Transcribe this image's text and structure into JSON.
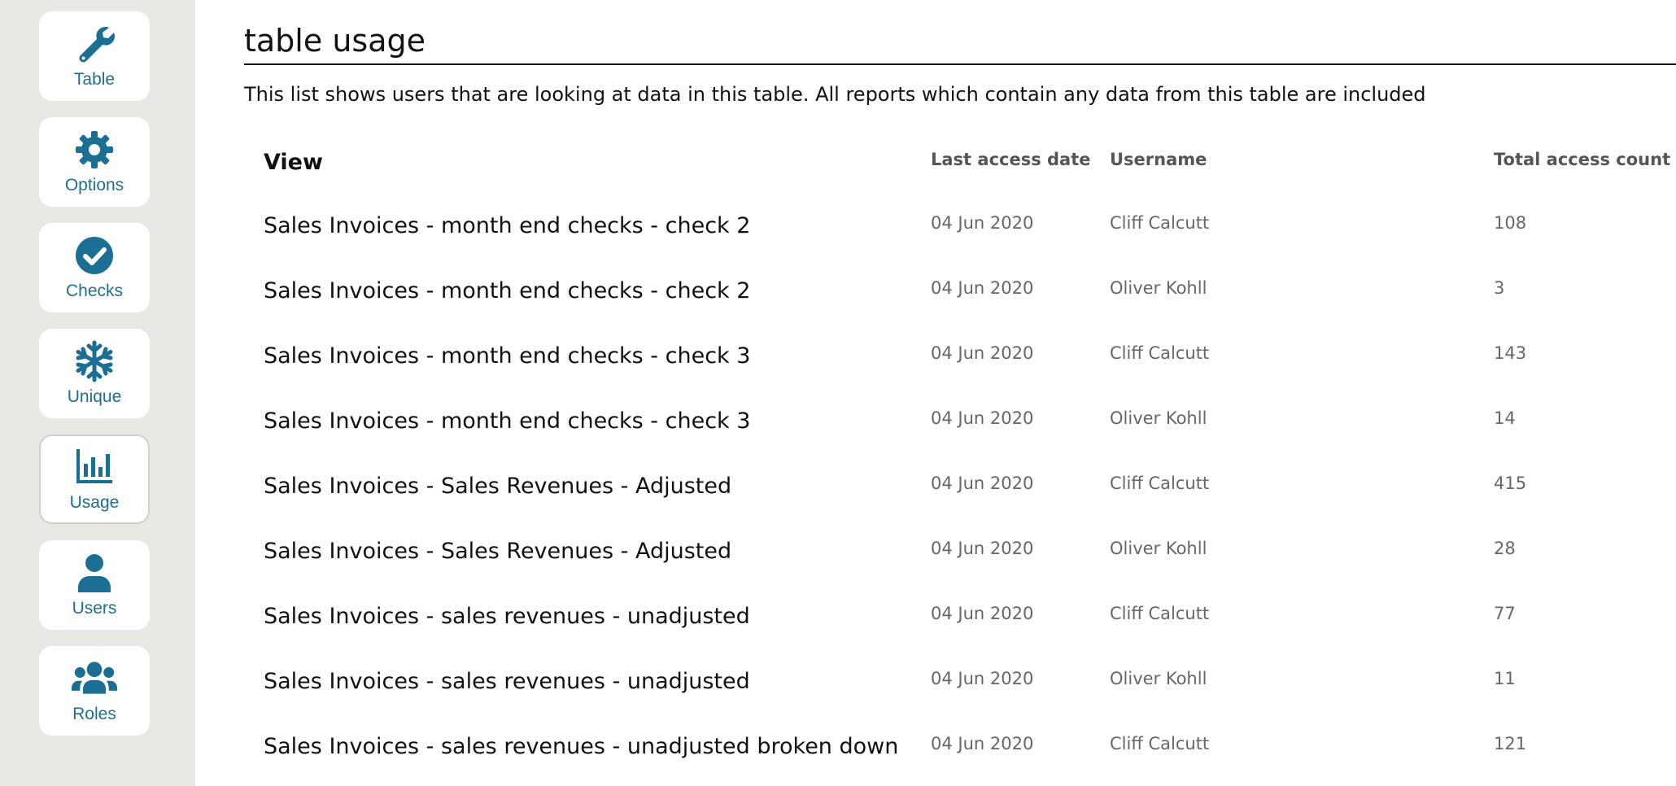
{
  "sidebar": {
    "items": [
      {
        "label": "Table",
        "icon": "wrench-icon"
      },
      {
        "label": "Options",
        "icon": "gear-icon"
      },
      {
        "label": "Checks",
        "icon": "check-circle-icon"
      },
      {
        "label": "Unique",
        "icon": "snowflake-icon"
      },
      {
        "label": "Usage",
        "icon": "bar-chart-icon",
        "active": true
      },
      {
        "label": "Users",
        "icon": "user-icon"
      },
      {
        "label": "Roles",
        "icon": "users-group-icon"
      }
    ]
  },
  "colors": {
    "accent": "#1b6f94",
    "sidebar_bg": "#e9e8e4"
  },
  "main": {
    "title": "table usage",
    "description": "This list shows users that are looking at data in this table. All reports which contain any data from this table are included",
    "table": {
      "headers": {
        "view": "View",
        "last_access": "Last access date",
        "username": "Username",
        "total_count": "Total access count"
      },
      "rows": [
        {
          "view": "Sales Invoices - month end checks - check 2",
          "date": "04 Jun 2020",
          "user": "Cliff Calcutt",
          "count": "108"
        },
        {
          "view": "Sales Invoices - month end checks - check 2",
          "date": "04 Jun 2020",
          "user": "Oliver Kohll",
          "count": "3"
        },
        {
          "view": "Sales Invoices - month end checks - check 3",
          "date": "04 Jun 2020",
          "user": "Cliff Calcutt",
          "count": "143"
        },
        {
          "view": "Sales Invoices - month end checks - check 3",
          "date": "04 Jun 2020",
          "user": "Oliver Kohll",
          "count": "14"
        },
        {
          "view": "Sales Invoices - Sales Revenues - Adjusted",
          "date": "04 Jun 2020",
          "user": "Cliff Calcutt",
          "count": "415"
        },
        {
          "view": "Sales Invoices - Sales Revenues - Adjusted",
          "date": "04 Jun 2020",
          "user": "Oliver Kohll",
          "count": "28"
        },
        {
          "view": "Sales Invoices - sales revenues - unadjusted",
          "date": "04 Jun 2020",
          "user": "Cliff Calcutt",
          "count": "77"
        },
        {
          "view": "Sales Invoices - sales revenues - unadjusted",
          "date": "04 Jun 2020",
          "user": "Oliver Kohll",
          "count": "11"
        },
        {
          "view": "Sales Invoices - sales revenues - unadjusted broken down",
          "date": "04 Jun 2020",
          "user": "Cliff Calcutt",
          "count": "121"
        }
      ]
    }
  }
}
